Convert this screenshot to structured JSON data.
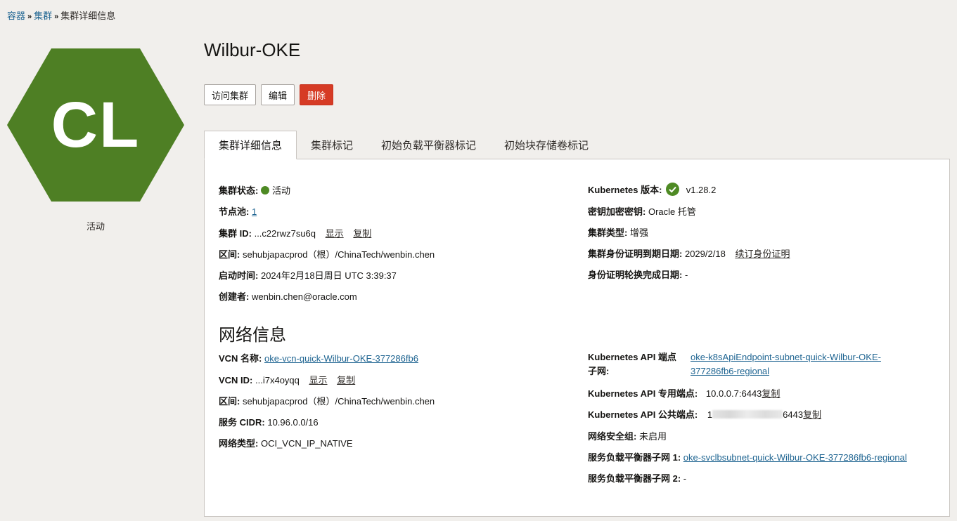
{
  "breadcrumb": {
    "item1": "容器",
    "item2": "集群",
    "current": "集群详细信息",
    "sep": "»"
  },
  "cluster": {
    "initials": "CL",
    "status": "活动",
    "name": "Wilbur-OKE"
  },
  "colors": {
    "hex": "#4e7f24",
    "status_green": "#4e8a24",
    "danger": "#d63b25",
    "link": "#1e6491"
  },
  "actions": {
    "access": "访问集群",
    "edit": "编辑",
    "delete": "删除"
  },
  "tabs": [
    "集群详细信息",
    "集群标记",
    "初始负载平衡器标记",
    "初始块存储卷标记"
  ],
  "details_left": {
    "status_label": "集群状态:",
    "status_value": "活动",
    "nodepool_label": "节点池:",
    "nodepool_value": "1",
    "id_label": "集群 ID:",
    "id_value": "...c22rwz7su6q",
    "show": "显示",
    "copy": "复制",
    "compartment_label": "区间:",
    "compartment_value": "sehubjapacprod（根）/ChinaTech/wenbin.chen",
    "start_label": "启动时间:",
    "start_value": "2024年2月18日周日 UTC 3:39:37",
    "creator_label": "创建者:",
    "creator_value": "wenbin.chen@oracle.com"
  },
  "details_right": {
    "k8s_label": "Kubernetes 版本:",
    "k8s_value": "v1.28.2",
    "kms_label": "密钥加密密钥:",
    "kms_value": "Oracle 托管",
    "type_label": "集群类型:",
    "type_value": "增强",
    "cert_label": "集群身份证明到期日期:",
    "cert_value": "2029/2/18",
    "cert_action": "续订身份证明",
    "rotation_label": "身份证明轮换完成日期:",
    "rotation_value": "-"
  },
  "network": {
    "title": "网络信息",
    "vcn_label": "VCN 名称:",
    "vcn_value": "oke-vcn-quick-Wilbur-OKE-377286fb6",
    "vcnid_label": "VCN ID:",
    "vcnid_value": "...i7x4oyqq",
    "show": "显示",
    "copy": "复制",
    "compartment_label": "区间:",
    "compartment_value": "sehubjapacprod（根）/ChinaTech/wenbin.chen",
    "cidr_label": "服务 CIDR:",
    "cidr_value": "10.96.0.0/16",
    "nettype_label": "网络类型:",
    "nettype_value": "OCI_VCN_IP_NATIVE",
    "api_subnet_label_1": "Kubernetes API 端点",
    "api_subnet_label_2": "子网:",
    "api_subnet_value_1": "oke-k8sApiEndpoint-subnet-quick-Wilbur-OKE-",
    "api_subnet_value_2": "377286fb6-regional",
    "private_label": "Kubernetes API 专用端点:",
    "private_value": "10.0.0.7:6443",
    "private_copy": "复制",
    "public_label": "Kubernetes API 公共端点:",
    "public_value_prefix": "1",
    "public_value_suffix": "6443",
    "public_copy": "复制",
    "nsg_label": "网络安全组:",
    "nsg_value": "未启用",
    "lb1_label": "服务负载平衡器子网 1:",
    "lb1_value": "oke-svclbsubnet-quick-Wilbur-OKE-377286fb6-regional",
    "lb2_label": "服务负载平衡器子网 2:",
    "lb2_value": "-"
  }
}
